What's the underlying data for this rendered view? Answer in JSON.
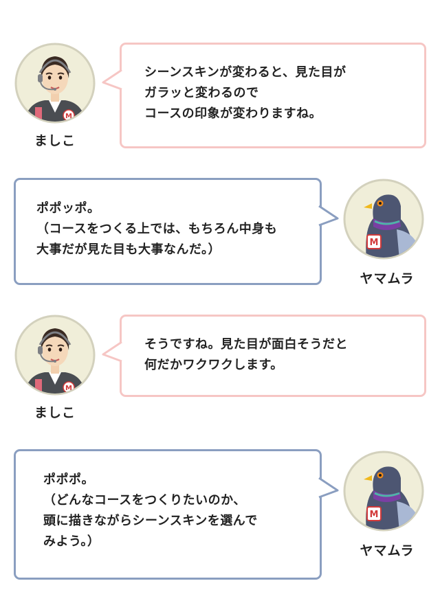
{
  "colors": {
    "pink_border": "#f6c6c4",
    "blue_border": "#8a9ec0",
    "avatar_bg": "#f0eed9",
    "avatar_ring": "#d3d1bd"
  },
  "conversation": [
    {
      "speaker": "ましこ",
      "avatar_icon": "operator-woman-icon",
      "lines": [
        "シーンスキンが変わると、見た目が",
        "ガラッと変わるので",
        "コースの印象が変わりますね。"
      ]
    },
    {
      "speaker": "ヤマムラ",
      "avatar_icon": "pigeon-icon",
      "lines": [
        "ポポッポ。",
        "（コースをつくる上では、もちろん中身も",
        "大事だが見た目も大事なんだ。）"
      ]
    },
    {
      "speaker": "ましこ",
      "avatar_icon": "operator-woman-icon",
      "lines": [
        "そうですね。見た目が面白そうだと",
        "何だかワクワクします。"
      ]
    },
    {
      "speaker": "ヤマムラ",
      "avatar_icon": "pigeon-icon",
      "lines": [
        "ポポポ。",
        "（どんなコースをつくりたいのか、",
        "頭に描きながらシーンスキンを選んで",
        "みよう。）"
      ]
    }
  ]
}
